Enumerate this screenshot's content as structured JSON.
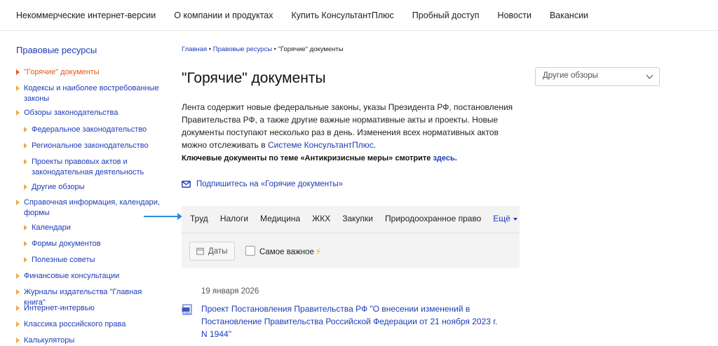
{
  "topnav": {
    "items": [
      "Некоммерческие интернет-версии",
      "О компании и продуктах",
      "Купить КонсультантПлюс",
      "Пробный доступ",
      "Новости",
      "Вакансии"
    ]
  },
  "sidebar": {
    "title": "Правовые ресурсы",
    "items": [
      {
        "label": "\"Горячие\" документы",
        "level": 0,
        "active": true
      },
      {
        "label": "Кодексы и наиболее востребованные законы",
        "level": 0
      },
      {
        "label": "Обзоры законодательства",
        "level": 0
      },
      {
        "label": "Федеральное законодательство",
        "level": 1
      },
      {
        "label": "Региональное законодательство",
        "level": 1
      },
      {
        "label": "Проекты правовых актов и законодательная деятельность",
        "level": 1
      },
      {
        "label": "Другие обзоры",
        "level": 1
      },
      {
        "label": "Справочная информация, календари, формы",
        "level": 0
      },
      {
        "label": "Календари",
        "level": 1
      },
      {
        "label": "Формы документов",
        "level": 1
      },
      {
        "label": "Полезные советы",
        "level": 1
      },
      {
        "label": "Финансовые консультации",
        "level": 0
      },
      {
        "label": "Журналы издательства \"Главная книга\"",
        "level": 0
      },
      {
        "label": "Интернет-интервью",
        "level": 0
      },
      {
        "label": "Классика российского права",
        "level": 0
      },
      {
        "label": "Калькуляторы",
        "level": 0
      }
    ]
  },
  "breadcrumb": {
    "home": "Главная",
    "sep": " • ",
    "section": "Правовые ресурсы",
    "current": "\"Горячие\" документы"
  },
  "main": {
    "title": "\"Горячие\" документы",
    "other_reviews": "Другие обзоры",
    "desc_text": "Лента содержит новые федеральные законы, указы Президента РФ, постановления Правительства РФ, а также другие важные нормативные акты и проекты. Новые документы поступают несколько раз в день. Изменения всех нормативных актов можно отслеживать в ",
    "desc_link": "Системе КонсультантПлюс",
    "desc_end": ".",
    "keydocs_text": "Ключевые документы по теме «Антикризисные меры» смотрите ",
    "keydocs_link": "здесь",
    "keydocs_end": ".",
    "subscribe": "Подпишитесь на «Горячие документы»"
  },
  "filters": {
    "tabs": [
      "Труд",
      "Налоги",
      "Медицина",
      "ЖКХ",
      "Закупки",
      "Природоохранное право"
    ],
    "more": "Ещё",
    "dates_button": "Даты",
    "important_label": "Самое важное",
    "important_checked": false
  },
  "documents": [
    {
      "date": "19 января 2026",
      "title": "Проект Постановления Правительства РФ \"О внесении изменений в Постановление Правительства Российской Федерации от 21 ноября 2023 г. N 1944\""
    }
  ],
  "colors": {
    "link": "#1d3bb8",
    "active": "#e05a1c",
    "bullet": "#f0a848",
    "arrow": "#2e8ad8",
    "bolt": "#f2a600"
  }
}
